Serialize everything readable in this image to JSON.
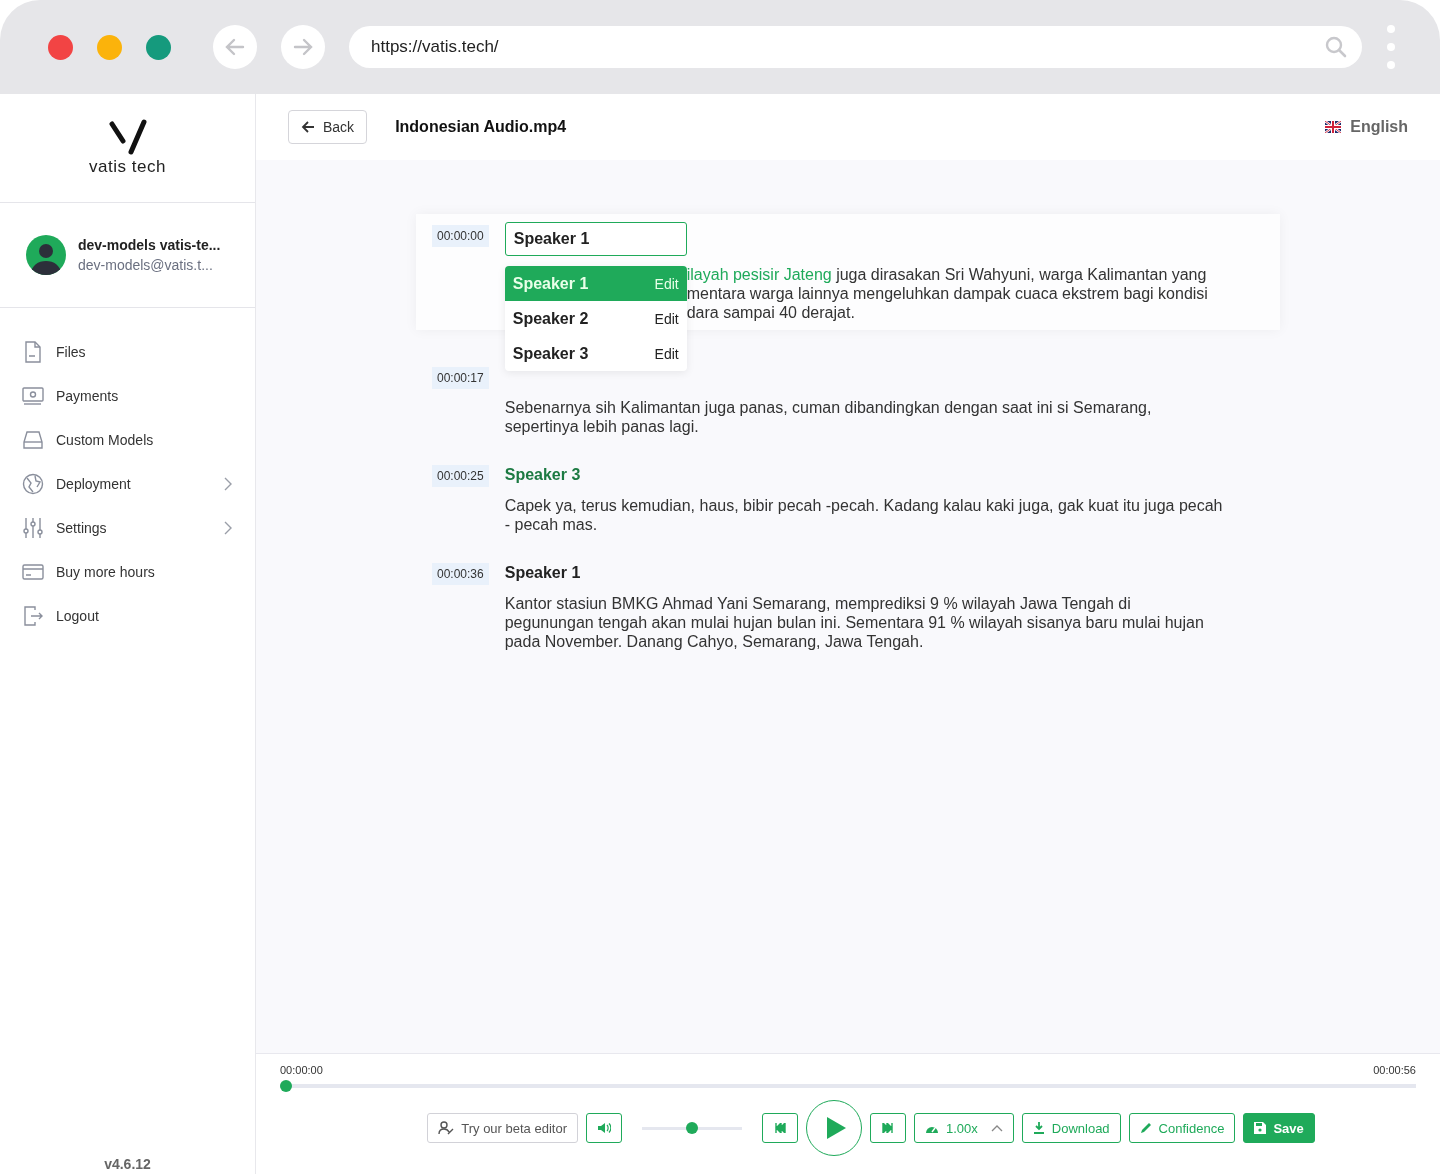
{
  "browser": {
    "url": "https://vatis.tech/"
  },
  "sidebar": {
    "logo": "vatis tech",
    "user": {
      "name": "dev-models vatis-te...",
      "email": "dev-models@vatis.t..."
    },
    "items": [
      {
        "label": "Files",
        "has_children": false
      },
      {
        "label": "Payments",
        "has_children": false
      },
      {
        "label": "Custom Models",
        "has_children": false
      },
      {
        "label": "Deployment",
        "has_children": true
      },
      {
        "label": "Settings",
        "has_children": true
      },
      {
        "label": "Buy more hours",
        "has_children": false
      },
      {
        "label": "Logout",
        "has_children": false
      }
    ],
    "version": "v4.6.12"
  },
  "header": {
    "back": "Back",
    "title": "Indonesian Audio.mp4",
    "language": "English"
  },
  "segments": [
    {
      "time": "00:00:00",
      "active": true,
      "speaker_input": "Speaker 1",
      "dropdown": [
        {
          "name": "Speaker 1",
          "action": "Edit",
          "selected": true
        },
        {
          "name": "Speaker 2",
          "action": "Edit",
          "selected": false
        },
        {
          "name": "Speaker 3",
          "action": "Edit",
          "selected": false
        }
      ],
      "lines": [
        {
          "highlight": "ilayah pesisir Jateng",
          "text": "juga dirasakan Sri Wahyuni, warga Kalimantan yang"
        },
        {
          "text": "mentara warga lainnya mengeluhkan dampak cuaca ekstrem bagi kondisi"
        },
        {
          "text": "dara sampai 40 derajat."
        }
      ]
    },
    {
      "time": "00:00:17",
      "active": false,
      "text": "Sebenarnya sih Kalimantan juga panas, cuman dibandingkan dengan saat ini si Semarang, sepertinya lebih panas lagi."
    },
    {
      "time": "00:00:25",
      "active": false,
      "speaker": "Speaker 3",
      "highlighted": true,
      "text": "Capek ya, terus kemudian, haus, bibir pecah -pecah. Kadang kalau kaki juga, gak kuat itu juga pecah - pecah mas."
    },
    {
      "time": "00:00:36",
      "active": false,
      "speaker": "Speaker 1",
      "highlighted": false,
      "text": "Kantor stasiun BMKG Ahmad Yani Semarang, memprediksi 9 % wilayah Jawa Tengah di pegunungan tengah akan mulai hujan bulan ini. Sementara 91 % wilayah sisanya baru mulai hujan pada November. Danang Cahyo, Semarang, Jawa Tengah."
    }
  ],
  "player": {
    "current": "00:00:00",
    "duration": "00:00:56",
    "seek": {
      "level": 0
    },
    "beta": "Try our beta editor",
    "volume": {
      "level": 0.5
    },
    "speed": "1.00x",
    "download": "Download",
    "confidence": "Confidence",
    "save": "Save"
  }
}
